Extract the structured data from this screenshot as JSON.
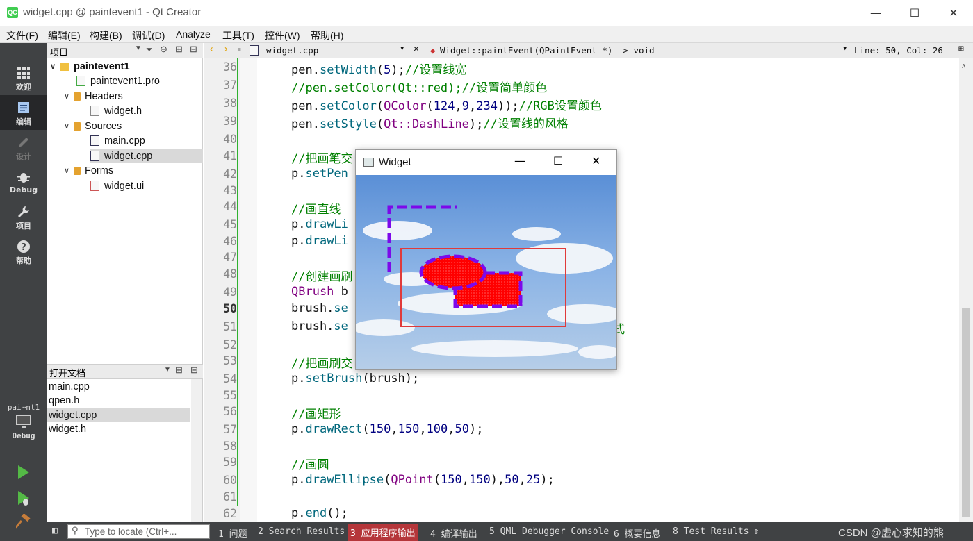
{
  "window": {
    "title": "widget.cpp @ paintevent1 - Qt Creator",
    "app_icon": "QC",
    "controls": {
      "minimize": "—",
      "maximize": "☐",
      "close": "✕"
    }
  },
  "menu": [
    "文件(F)",
    "编辑(E)",
    "构建(B)",
    "调试(D)",
    "Analyze",
    "工具(T)",
    "控件(W)",
    "帮助(H)"
  ],
  "modes": [
    {
      "label": "欢迎",
      "icon": "grid-icon"
    },
    {
      "label": "编辑",
      "icon": "document-icon"
    },
    {
      "label": "设计",
      "icon": "pencil-icon"
    },
    {
      "label": "Debug",
      "icon": "bug-icon"
    },
    {
      "label": "项目",
      "icon": "wrench-icon"
    },
    {
      "label": "帮助",
      "icon": "help-icon"
    }
  ],
  "target": {
    "project": "pai⋯nt1",
    "kit": "Debug"
  },
  "project_panel": {
    "title": "项目",
    "tree": {
      "root": "paintevent1",
      "pro": "paintevent1.pro",
      "headers": "Headers",
      "widget_h": "widget.h",
      "sources": "Sources",
      "main_cpp": "main.cpp",
      "widget_cpp": "widget.cpp",
      "forms": "Forms",
      "widget_ui": "widget.ui"
    }
  },
  "open_docs": {
    "title": "打开文档",
    "items": [
      "main.cpp",
      "qpen.h",
      "widget.cpp",
      "widget.h"
    ]
  },
  "editor_header": {
    "file": "widget.cpp",
    "symbol": "Widget::paintEvent(QPaintEvent *) -> void",
    "position": "Line: 50, Col: 26"
  },
  "line_numbers": [
    "36",
    "37",
    "38",
    "39",
    "40",
    "41",
    "42",
    "43",
    "44",
    "45",
    "46",
    "47",
    "48",
    "49",
    "50",
    "51",
    "52",
    "53",
    "54",
    "55",
    "56",
    "57",
    "58",
    "59",
    "60",
    "61",
    "62"
  ],
  "code": {
    "l36a": "pen.",
    "l36b": "setWidth",
    "l36c": "(",
    "l36d": "5",
    "l36e": ");",
    "l36f": "//设置线宽",
    "l37": "//pen.setColor(Qt::red);//设置简单颜色",
    "l38a": "pen.",
    "l38b": "setColor",
    "l38c": "(",
    "l38d": "QColor",
    "l38e": "(",
    "l38f": "124",
    "l38g": ",",
    "l38h": "9",
    "l38i": ",",
    "l38j": "234",
    "l38k": "));",
    "l38l": "//RGB设置颜色",
    "l39a": "pen.",
    "l39b": "setStyle",
    "l39c": "(",
    "l39d": "Qt::DashLine",
    "l39e": ");",
    "l39f": "//设置线的风格",
    "l41": "//把画笔交",
    "l42a": "p.",
    "l42b": "setPen",
    "l44": "//画直线",
    "l45a": "p.",
    "l45b": "drawLi",
    "l46a": "p.",
    "l46b": "drawLi",
    "l48": "//创建画刷",
    "l49a": "QBrush",
    "l49b": " b",
    "l50a": "brush.",
    "l50b": "se",
    "l51a": "brush.",
    "l51b": "se",
    "l51c": "式",
    "l53": "//把画刷交",
    "l54a": "p.",
    "l54b": "setBrush",
    "l54c": "(brush);",
    "l56": "//画矩形",
    "l57a": "p.",
    "l57b": "drawRect",
    "l57c": "(",
    "l57d": "150",
    "l57e": ",",
    "l57f": "150",
    "l57g": ",",
    "l57h": "100",
    "l57i": ",",
    "l57j": "50",
    "l57k": ");",
    "l59": "//画圆",
    "l60a": "p.",
    "l60b": "drawEllipse",
    "l60c": "(",
    "l60d": "QPoint",
    "l60e": "(",
    "l60f": "150",
    "l60g": ",",
    "l60h": "150",
    "l60i": "),",
    "l60j": "50",
    "l60k": ",",
    "l60l": "25",
    "l60m": ");",
    "l62a": "p.",
    "l62b": "end",
    "l62c": "();"
  },
  "popup": {
    "title": "Widget"
  },
  "locator": {
    "placeholder": "Type to locate (Ctrl+..."
  },
  "status_items": [
    "1 问题",
    "2 Search Results",
    "3 应用程序输出",
    "4 编译输出",
    "5 QML Debugger Console",
    "6 概要信息",
    "8 Test Results"
  ],
  "watermark": "CSDN @虚心求知的熊",
  "colors": {
    "pen": "#7c09ea",
    "brush": "#ff0000",
    "accent": "#41cd52",
    "active_output": "#b5363a"
  }
}
